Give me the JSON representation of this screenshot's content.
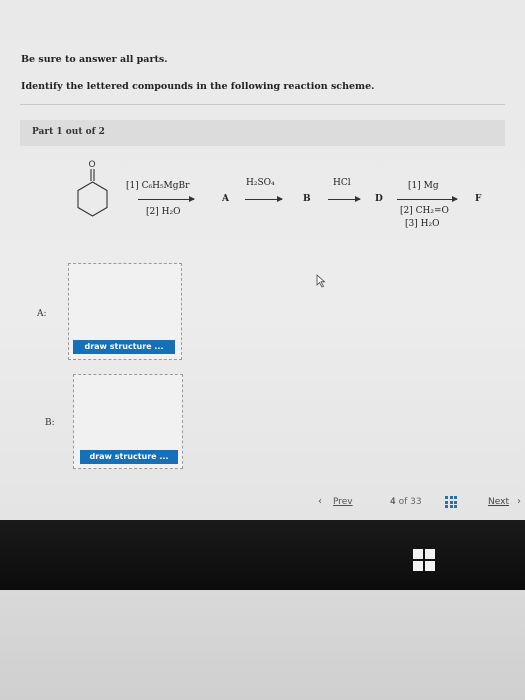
{
  "instructions": {
    "line1": "Be sure to answer all parts.",
    "line2": "Identify the lettered compounds in the following reaction scheme."
  },
  "part": {
    "label": "Part 1 out of 2"
  },
  "scheme": {
    "step1": {
      "reagent_top": "[1] C₆H₅MgBr",
      "reagent_bottom": "[2] H₂O",
      "product": "A"
    },
    "step2": {
      "reagent_top": "H₂SO₄",
      "product": "B"
    },
    "step3": {
      "reagent_top": "HCl",
      "product": "D"
    },
    "step4": {
      "reagent_top": "[1] Mg",
      "reagent_bottom1": "[2] CH₂=O",
      "reagent_bottom2": "[3] H₂O",
      "product": "F"
    }
  },
  "answers": {
    "a": {
      "label": "A:",
      "button": "draw structure ..."
    },
    "b": {
      "label": "B:",
      "button": "draw structure ..."
    }
  },
  "nav": {
    "prev": "Prev",
    "current": "4",
    "of": "of 33",
    "next": "Next"
  },
  "colors": {
    "button_blue": "#1670b8",
    "bezel": "#111111"
  }
}
